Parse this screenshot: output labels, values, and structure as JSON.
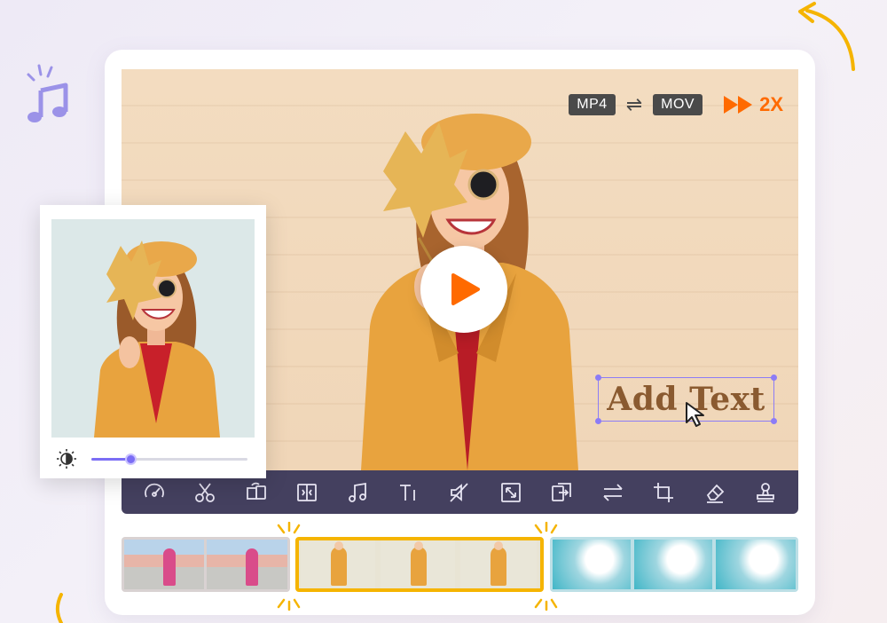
{
  "format": {
    "from": "MP4",
    "swap_icon": "swap-arrows-icon",
    "to": "MOV"
  },
  "speed": {
    "label": "2X",
    "icon": "fast-forward-icon",
    "color": "#ff6a00"
  },
  "overlay_text": "Add Text",
  "toolbar": {
    "items": [
      {
        "name": "speed-tool",
        "icon": "speedometer-icon"
      },
      {
        "name": "cut-tool",
        "icon": "scissors-icon"
      },
      {
        "name": "rotate-tool",
        "icon": "rotate-icon"
      },
      {
        "name": "split-tool",
        "icon": "split-icon"
      },
      {
        "name": "music-tool",
        "icon": "music-note-icon"
      },
      {
        "name": "text-tool",
        "icon": "text-icon"
      },
      {
        "name": "mute-tool",
        "icon": "mute-icon"
      },
      {
        "name": "resize-tool",
        "icon": "resize-icon"
      },
      {
        "name": "export-tool",
        "icon": "export-icon"
      },
      {
        "name": "convert-tool",
        "icon": "convert-arrows-icon"
      },
      {
        "name": "crop-tool",
        "icon": "crop-icon"
      },
      {
        "name": "eraser-tool",
        "icon": "eraser-icon"
      },
      {
        "name": "stamp-tool",
        "icon": "stamp-icon"
      }
    ]
  },
  "brightness": {
    "icon": "brightness-icon",
    "value": 0.25
  },
  "timeline": {
    "clips": [
      {
        "name": "street-clip",
        "frames": 2
      },
      {
        "name": "autumn-clip",
        "frames": 3,
        "selected": true
      },
      {
        "name": "ocean-clip",
        "frames": 3
      }
    ]
  },
  "colors": {
    "accent": "#7b6df5",
    "toolbar_bg": "#44405f",
    "selection": "#f5b400",
    "play": "#ff6a00"
  }
}
